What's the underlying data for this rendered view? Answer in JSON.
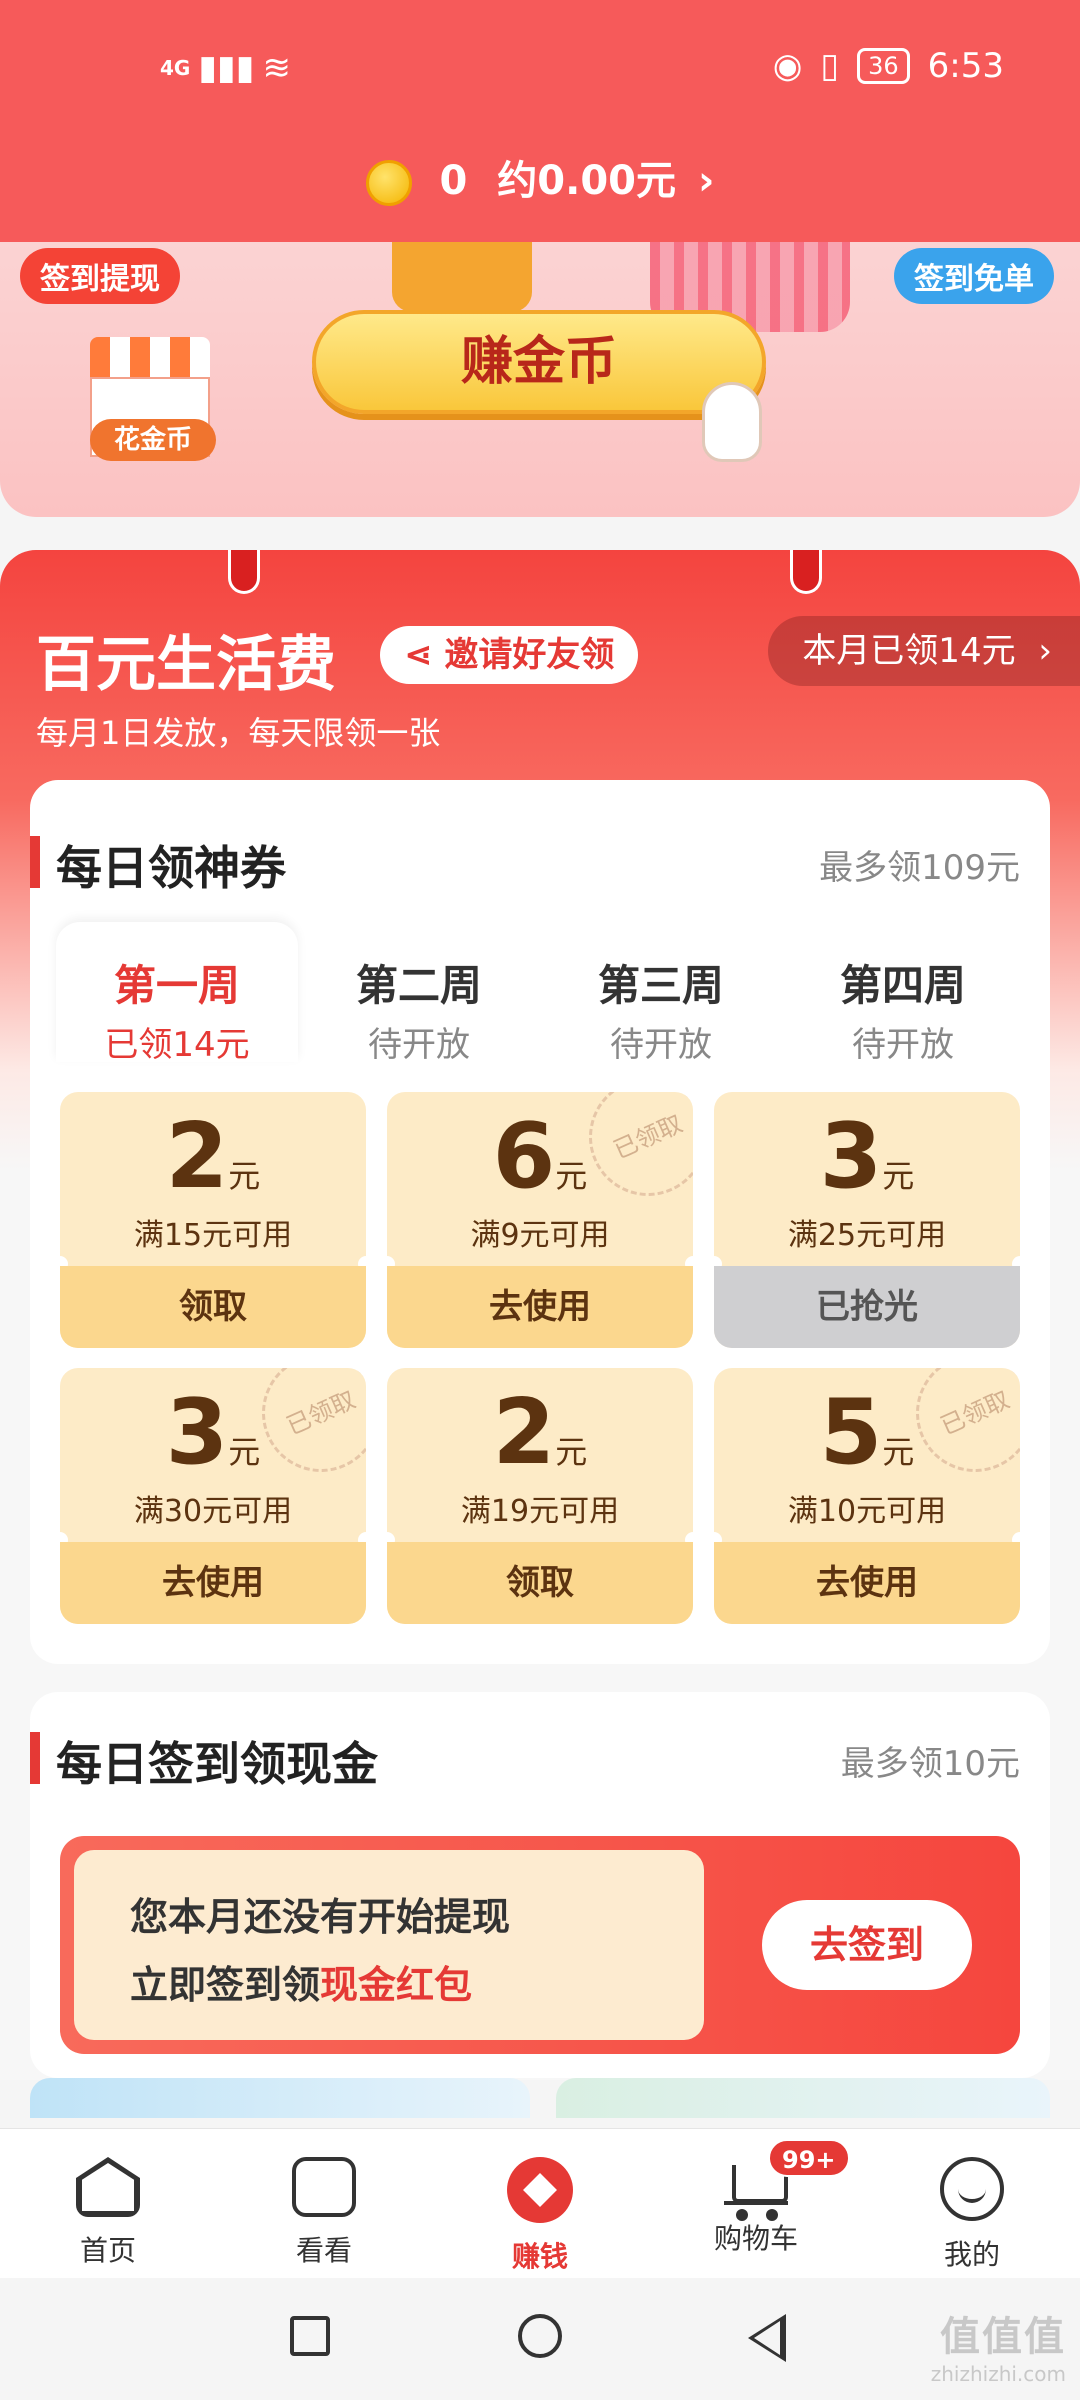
{
  "status_bar": {
    "network": "4G",
    "battery": "36",
    "time": "6:53"
  },
  "header": {
    "coins": "0",
    "approx": "约0.00元",
    "chevron": "›"
  },
  "banner": {
    "left_tag": "签到提现",
    "right_tag": "签到免单",
    "shop_label": "花金币",
    "earn_button": "赚金币"
  },
  "living": {
    "title": "百元生活费",
    "invite": "邀请好友领",
    "month_claimed": "本月已领14元",
    "subtitle": "每月1日发放，每天限领一张"
  },
  "coupons_card": {
    "title": "每日领神券",
    "max": "最多领109元",
    "weeks": [
      {
        "name": "第一周",
        "status": "已领14元"
      },
      {
        "name": "第二周",
        "status": "待开放"
      },
      {
        "name": "第三周",
        "status": "待开放"
      },
      {
        "name": "第四周",
        "status": "待开放"
      }
    ],
    "stamp_text": "已领取",
    "unit": "元",
    "items": [
      {
        "amount": "2",
        "condition": "满15元可用",
        "action": "领取"
      },
      {
        "amount": "6",
        "condition": "满9元可用",
        "action": "去使用"
      },
      {
        "amount": "3",
        "condition": "满25元可用",
        "action": "已抢光"
      },
      {
        "amount": "3",
        "condition": "满30元可用",
        "action": "去使用"
      },
      {
        "amount": "2",
        "condition": "满19元可用",
        "action": "领取"
      },
      {
        "amount": "5",
        "condition": "满10元可用",
        "action": "去使用"
      }
    ]
  },
  "cash_card": {
    "title": "每日签到领现金",
    "max": "最多领10元",
    "line1": "您本月还没有开始提现",
    "line2_prefix": "立即签到领",
    "line2_highlight": "现金红包",
    "button": "去签到"
  },
  "bottom_nav": {
    "items": [
      {
        "label": "首页",
        "icon": "home-icon"
      },
      {
        "label": "看看",
        "icon": "video-icon"
      },
      {
        "label": "赚钱",
        "icon": "earn-icon"
      },
      {
        "label": "购物车",
        "icon": "cart-icon"
      },
      {
        "label": "我的",
        "icon": "profile-icon"
      }
    ],
    "cart_badge": "99+"
  },
  "watermark": {
    "line1": "值值值",
    "line2": "zhizhizhi.com"
  },
  "colors": {
    "accent": "#e53935",
    "header": "#f65a5a",
    "coupon_bg": "#fdebc7",
    "coupon_action": "#fbd78e"
  }
}
